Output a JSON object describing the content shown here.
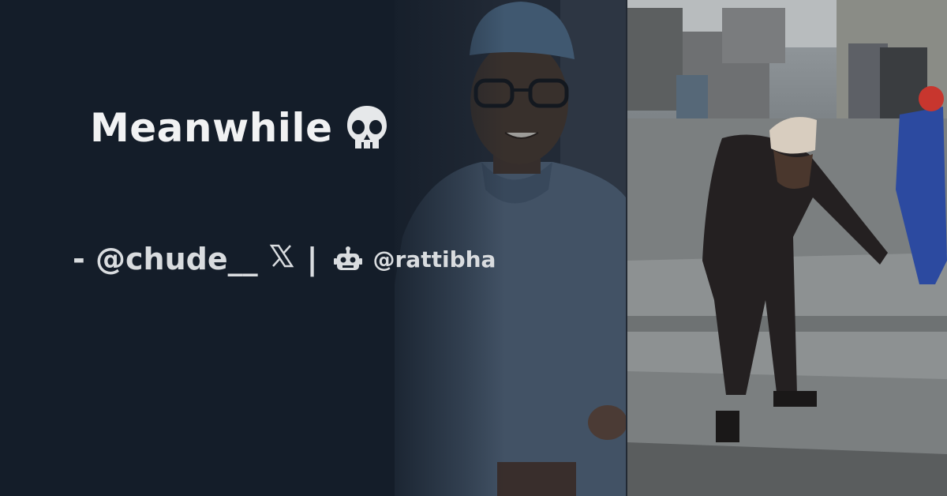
{
  "card": {
    "title": "Meanwhile",
    "title_emoji": "skull-icon",
    "author": "- @chude__",
    "platform_icon": "x-logo-icon",
    "separator": "|",
    "bot_icon": "robot-icon",
    "bot_handle": "@rattibha"
  },
  "colors": {
    "background": "#141d29",
    "text": "#f1f2f3",
    "subtext": "#d9dcdf"
  }
}
